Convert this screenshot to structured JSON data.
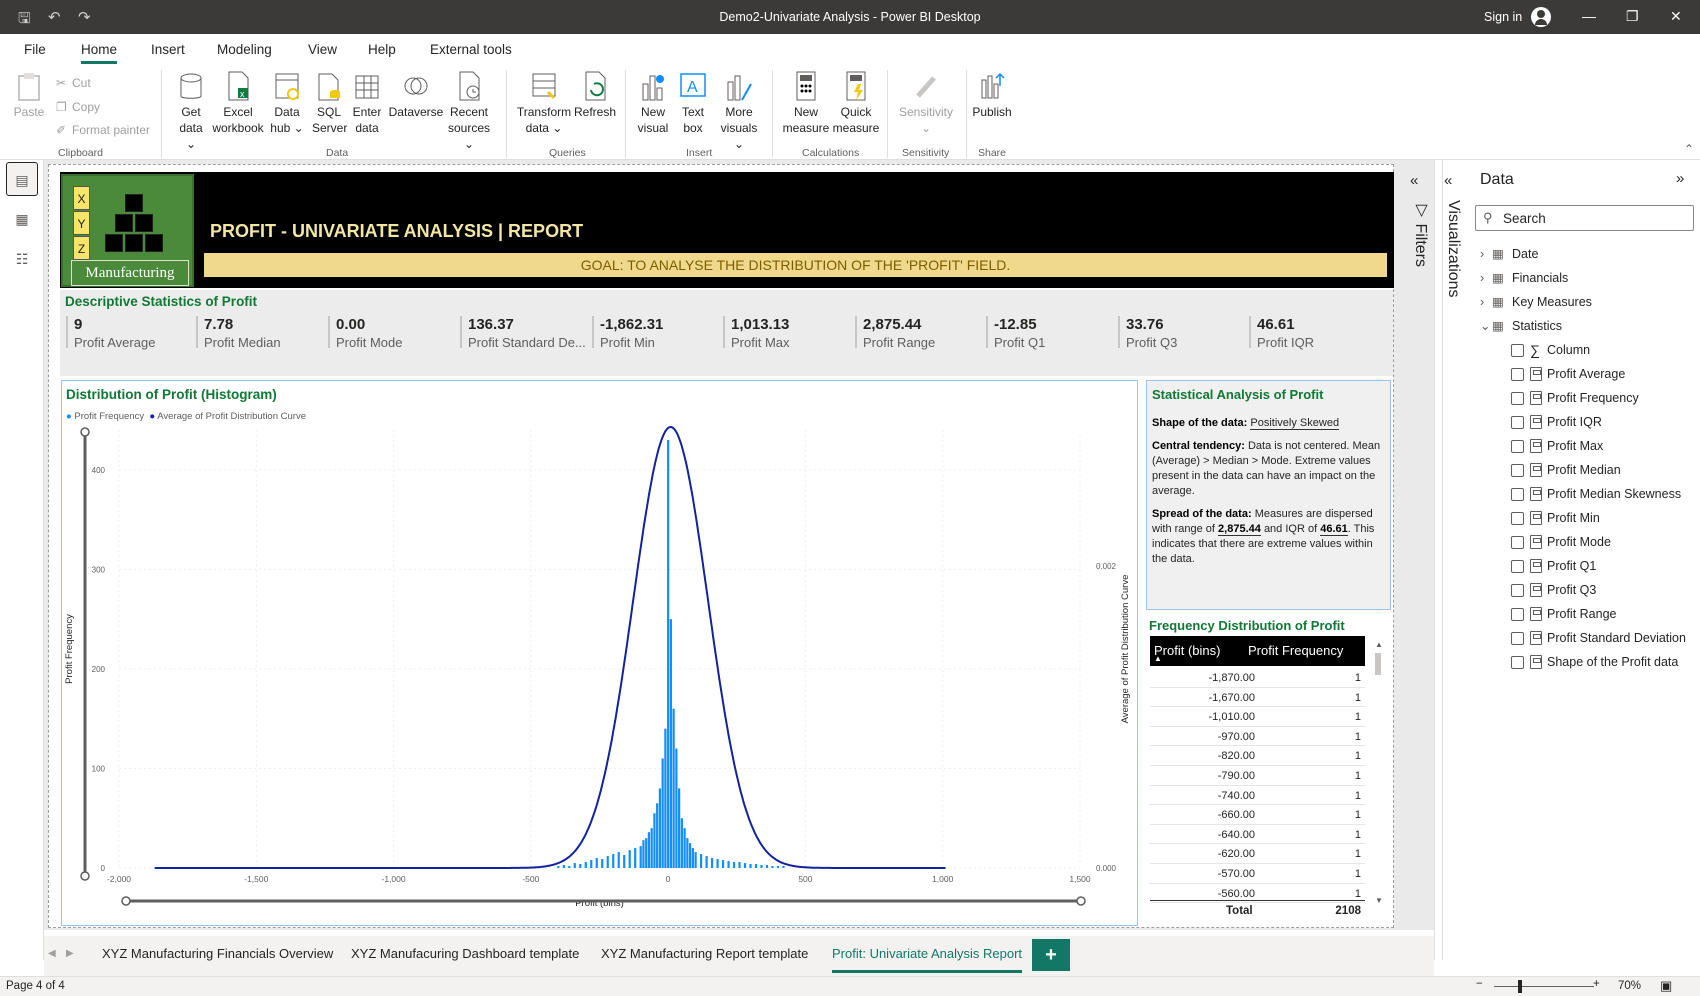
{
  "window": {
    "title": "Demo2-Univariate Analysis - Power BI Desktop",
    "signin": "Sign in"
  },
  "menu": {
    "items": [
      "File",
      "Home",
      "Insert",
      "Modeling",
      "View",
      "Help",
      "External tools"
    ],
    "active": "Home"
  },
  "ribbon": {
    "clipboard": {
      "paste": "Paste",
      "cut": "Cut",
      "copy": "Copy",
      "format_painter": "Format painter",
      "group": "Clipboard"
    },
    "data": {
      "get_data": [
        "Get",
        "data"
      ],
      "excel": [
        "Excel",
        "workbook"
      ],
      "data_hub": [
        "Data",
        "hub"
      ],
      "sql": [
        "SQL",
        "Server"
      ],
      "enter": [
        "Enter",
        "data"
      ],
      "dataverse": "Dataverse",
      "recent": [
        "Recent",
        "sources"
      ],
      "group": "Data"
    },
    "queries": {
      "transform": [
        "Transform",
        "data"
      ],
      "refresh": "Refresh",
      "group": "Queries"
    },
    "insert": {
      "new_visual": [
        "New",
        "visual"
      ],
      "text_box": [
        "Text",
        "box"
      ],
      "more_visuals": [
        "More",
        "visuals"
      ],
      "group": "Insert"
    },
    "calculations": {
      "new_measure": [
        "New",
        "measure"
      ],
      "quick_measure": [
        "Quick",
        "measure"
      ],
      "group": "Calculations"
    },
    "sensitivity": {
      "label": "Sensitivity",
      "group": "Sensitivity"
    },
    "share": {
      "publish": "Publish",
      "group": "Share"
    }
  },
  "report": {
    "logo": {
      "letters": [
        "X",
        "Y",
        "Z"
      ],
      "text": "Manufacturing"
    },
    "title": "PROFIT - UNIVARIATE ANALYSIS | REPORT",
    "goal": "GOAL: TO ANALYSE THE DISTRIBUTION OF THE 'PROFIT' FIELD.",
    "descriptive": {
      "title": "Descriptive Statistics of Profit",
      "kpis": [
        {
          "value": "9",
          "label": "Profit Average"
        },
        {
          "value": "7.78",
          "label": "Profit Median"
        },
        {
          "value": "0.00",
          "label": "Profit Mode"
        },
        {
          "value": "136.37",
          "label": "Profit Standard De..."
        },
        {
          "value": "-1,862.31",
          "label": "Profit Min"
        },
        {
          "value": "1,013.13",
          "label": "Profit Max"
        },
        {
          "value": "2,875.44",
          "label": "Profit Range"
        },
        {
          "value": "-12.85",
          "label": "Profit Q1"
        },
        {
          "value": "33.76",
          "label": "Profit Q3"
        },
        {
          "value": "46.61",
          "label": "Profit IQR"
        }
      ]
    },
    "histogram": {
      "title": "Distribution of Profit (Histogram)",
      "legend": [
        "Profit Frequency",
        "Average of Profit Distribution Curve"
      ]
    },
    "stat_analysis": {
      "title": "Statistical Analysis of Profit",
      "shape_label": "Shape of the data:",
      "shape_value": "Positively Skewed",
      "central_label": "Central tendency:",
      "central_text": "Data is not centered. Mean (Average) > Median > Mode. Extreme values present in the data can have an impact on the average.",
      "spread_label": "Spread of the data:",
      "spread_text1": "Measures are dispersed with range of",
      "spread_range": "2,875.44",
      "spread_text2": "and IQR of",
      "spread_iqr": "46.61",
      "spread_text3": ". This indicates that there are extreme values within the data."
    },
    "freq_table": {
      "title": "Frequency Distribution of Profit",
      "headers": [
        "Profit (bins)",
        "Profit Frequency"
      ],
      "rows": [
        [
          "-1,870.00",
          "1"
        ],
        [
          "-1,670.00",
          "1"
        ],
        [
          "-1,010.00",
          "1"
        ],
        [
          "-970.00",
          "1"
        ],
        [
          "-820.00",
          "1"
        ],
        [
          "-790.00",
          "1"
        ],
        [
          "-740.00",
          "1"
        ],
        [
          "-660.00",
          "1"
        ],
        [
          "-640.00",
          "1"
        ],
        [
          "-620.00",
          "1"
        ],
        [
          "-570.00",
          "1"
        ],
        [
          "-560.00",
          "1"
        ]
      ],
      "total_label": "Total",
      "total_value": "2108"
    }
  },
  "chart_data": {
    "type": "bar",
    "title": "Distribution of Profit (Histogram)",
    "xlabel": "Profit (bins)",
    "ylabel": "Profit Frequency",
    "y2label": "Average of Profit Distribution Curve",
    "xlim": [
      -2000,
      1500
    ],
    "ylim": [
      0,
      440
    ],
    "y2lim": [
      0,
      0.0029
    ],
    "x_ticks": [
      "-2,000",
      "-1,500",
      "-1,000",
      "-500",
      "0",
      "500",
      "1,000",
      "1,500"
    ],
    "y_ticks": [
      "0",
      "100",
      "200",
      "300",
      "400"
    ],
    "y2_ticks": [
      "0.000",
      "0.002"
    ],
    "series": [
      {
        "name": "Profit Frequency",
        "color": "#118dff",
        "x": [
          -400,
          -380,
          -360,
          -340,
          -320,
          -300,
          -280,
          -260,
          -240,
          -220,
          -200,
          -180,
          -160,
          -140,
          -120,
          -100,
          -90,
          -80,
          -70,
          -60,
          -50,
          -40,
          -30,
          -20,
          -10,
          0,
          10,
          20,
          30,
          40,
          50,
          60,
          70,
          80,
          90,
          100,
          120,
          140,
          160,
          180,
          200,
          220,
          240,
          260,
          280,
          300,
          320,
          340,
          360,
          380,
          400,
          420
        ],
        "y": [
          2,
          3,
          2,
          5,
          4,
          6,
          8,
          10,
          9,
          12,
          14,
          16,
          13,
          18,
          20,
          22,
          28,
          30,
          36,
          40,
          55,
          65,
          80,
          110,
          140,
          430,
          250,
          160,
          120,
          80,
          50,
          40,
          30,
          25,
          20,
          16,
          14,
          12,
          10,
          9,
          8,
          7,
          6,
          6,
          5,
          4,
          4,
          3,
          3,
          2,
          2,
          2
        ]
      },
      {
        "name": "Average of Profit Distribution Curve",
        "color": "#12239e",
        "type": "line",
        "mean": 9,
        "std": 136.37,
        "peak": 0.00292
      }
    ]
  },
  "data_pane": {
    "title": "Data",
    "search_placeholder": "Search",
    "tables": [
      "Date",
      "Financials",
      "Key Measures",
      "Statistics"
    ],
    "fields": [
      "Column",
      "Profit Average",
      "Profit Frequency",
      "Profit IQR",
      "Profit Max",
      "Profit Median",
      "Profit Median Skewness",
      "Profit Min",
      "Profit Mode",
      "Profit Q1",
      "Profit Q3",
      "Profit Range",
      "Profit Standard Deviation",
      "Shape of the Profit data"
    ]
  },
  "panes": {
    "filters": "Filters",
    "visualizations": "Visualizations"
  },
  "tabs": [
    "XYZ Manufacturing Financials Overview",
    "XYZ Manufacuring Dashboard template",
    "XYZ Manufacturing Report template",
    "Profit: Univariate Analysis Report"
  ],
  "active_tab": "Profit: Univariate Analysis Report",
  "status": {
    "page": "Page 4 of 4",
    "zoom": "70%"
  }
}
